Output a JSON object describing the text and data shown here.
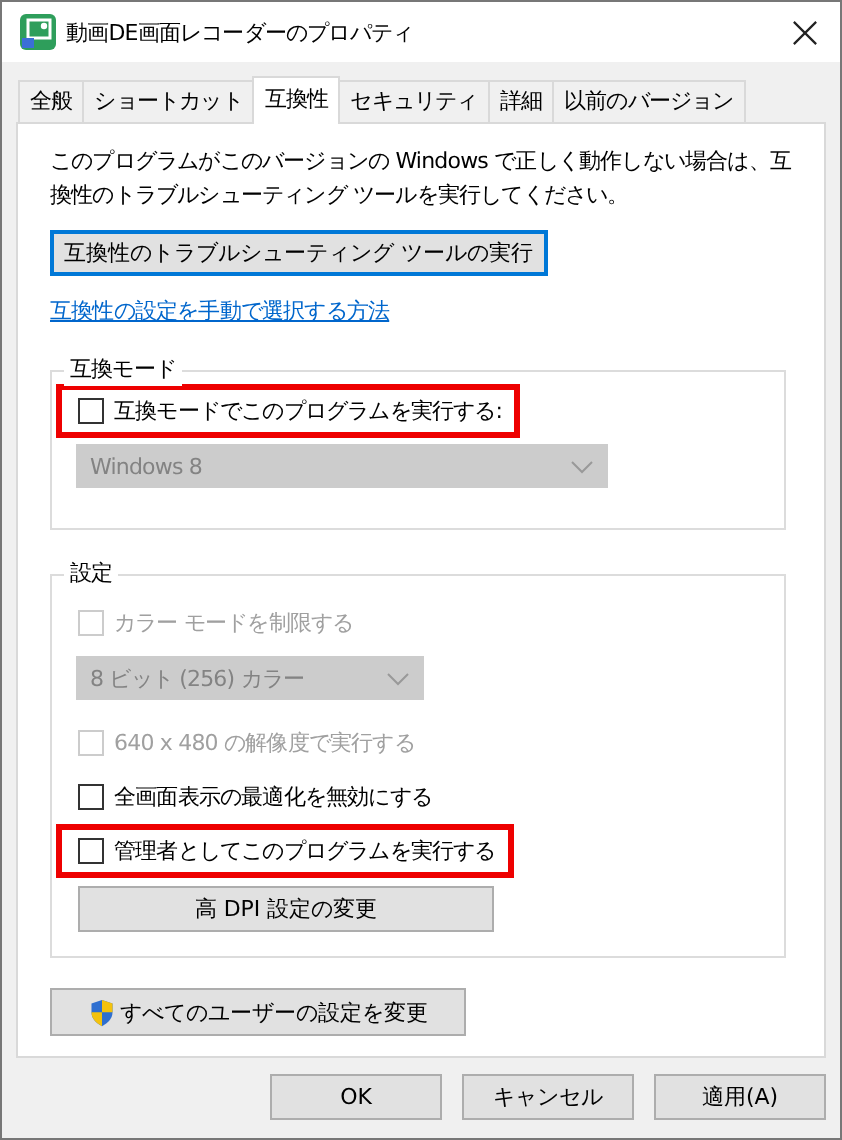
{
  "window": {
    "title": "動画DE画面レコーダーのプロパティ"
  },
  "tabs": [
    {
      "label": "全般",
      "selected": false
    },
    {
      "label": "ショートカット",
      "selected": false
    },
    {
      "label": "互換性",
      "selected": true
    },
    {
      "label": "セキュリティ",
      "selected": false
    },
    {
      "label": "詳細",
      "selected": false
    },
    {
      "label": "以前のバージョン",
      "selected": false
    }
  ],
  "compatibility": {
    "description": "このプログラムがこのバージョンの Windows で正しく動作しない場合は、互換性のトラブルシューティング ツールを実行してください。",
    "troubleshoot_button": "互換性のトラブルシューティング ツールの実行",
    "manual_link": "互換性の設定を手動で選択する方法",
    "groups": [
      {
        "legend": "互換モード",
        "items": [
          {
            "kind": "checkbox",
            "label": "互換モードでこのプログラムを実行する:",
            "checked": false,
            "disabled": false,
            "highlighted": true
          },
          {
            "kind": "dropdown",
            "value": "Windows 8",
            "disabled": true
          }
        ]
      },
      {
        "legend": "設定",
        "items": [
          {
            "kind": "checkbox",
            "label": "カラー モードを制限する",
            "checked": false,
            "disabled": true,
            "highlighted": false
          },
          {
            "kind": "dropdown",
            "value": "8 ビット (256) カラー",
            "disabled": true
          },
          {
            "kind": "checkbox",
            "label": "640 x 480 の解像度で実行する",
            "checked": false,
            "disabled": true,
            "highlighted": false
          },
          {
            "kind": "checkbox",
            "label": "全画面表示の最適化を無効にする",
            "checked": false,
            "disabled": false,
            "highlighted": false
          },
          {
            "kind": "checkbox",
            "label": "管理者としてこのプログラムを実行する",
            "checked": false,
            "disabled": false,
            "highlighted": true
          },
          {
            "kind": "button",
            "label": "高 DPI 設定の変更"
          }
        ]
      }
    ],
    "all_users_button": "すべてのユーザーの設定を変更"
  },
  "buttons": [
    {
      "label": "OK"
    },
    {
      "label": "キャンセル"
    },
    {
      "label": "適用(A)"
    }
  ]
}
